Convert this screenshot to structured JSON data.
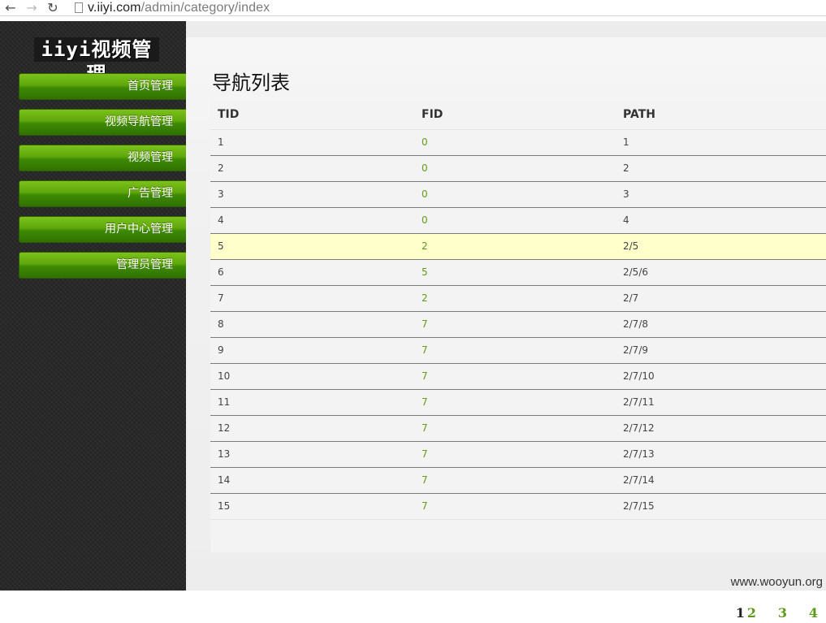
{
  "browser": {
    "back_icon": "←",
    "forward_icon": "→",
    "reload_icon": "↻",
    "url_host": "v.iiyi.com",
    "url_path": "/admin/category/index"
  },
  "sidebar": {
    "logo": "iiyi视频管理",
    "items": [
      {
        "label": "首页管理"
      },
      {
        "label": "视频导航管理"
      },
      {
        "label": "视频管理"
      },
      {
        "label": "广告管理"
      },
      {
        "label": "用户中心管理"
      },
      {
        "label": "管理员管理"
      }
    ]
  },
  "main": {
    "title": "导航列表",
    "table": {
      "headers": [
        "TID",
        "FID",
        "PATH"
      ],
      "rows": [
        [
          "1",
          "0",
          "1"
        ],
        [
          "2",
          "0",
          "2"
        ],
        [
          "3",
          "0",
          "3"
        ],
        [
          "4",
          "0",
          "4"
        ],
        [
          "5",
          "2",
          "2/5"
        ],
        [
          "6",
          "5",
          "2/5/6"
        ],
        [
          "7",
          "2",
          "2/7"
        ],
        [
          "8",
          "7",
          "2/7/8"
        ],
        [
          "9",
          "7",
          "2/7/9"
        ],
        [
          "10",
          "7",
          "2/7/10"
        ],
        [
          "11",
          "7",
          "2/7/11"
        ],
        [
          "12",
          "7",
          "2/7/12"
        ],
        [
          "13",
          "7",
          "2/7/13"
        ],
        [
          "14",
          "7",
          "2/7/14"
        ],
        [
          "15",
          "7",
          "2/7/15"
        ]
      ],
      "highlighted_row": 4
    },
    "pagination": {
      "current": "1",
      "pages": [
        "2",
        "3",
        "4"
      ]
    }
  },
  "watermark": "www.wooyun.org",
  "colors": {
    "accent_green": "#5e9b18",
    "menu_green": "#5fa60c",
    "highlight_row": "#ffffcc"
  }
}
